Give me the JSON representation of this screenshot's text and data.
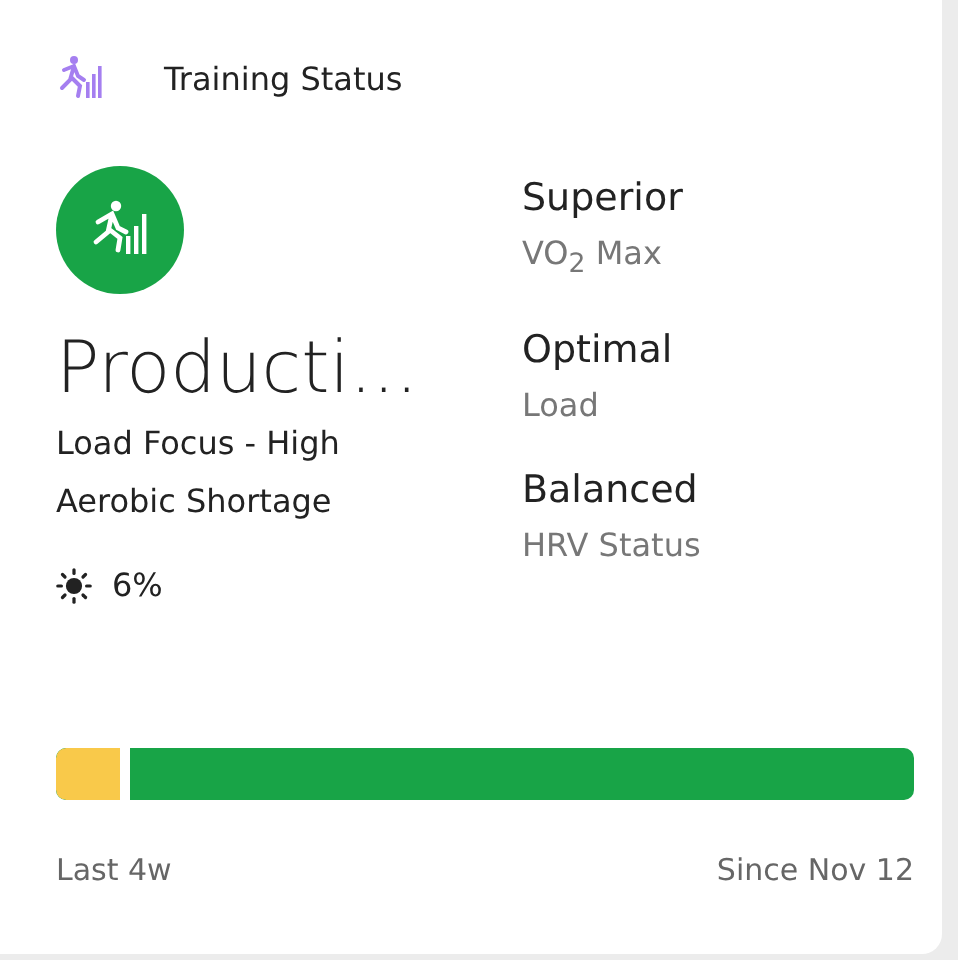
{
  "card": {
    "title": "Training Status"
  },
  "status": {
    "label": "Producti...",
    "details": [
      "Load Focus - High",
      "Aerobic Shortage"
    ],
    "heat": "6%"
  },
  "metrics": [
    {
      "value": "Superior",
      "label": "VO$_{2}$ Max"
    },
    {
      "value": "Optimal",
      "label": "Load"
    },
    {
      "value": "Balanced",
      "label": "HRV Status"
    }
  ],
  "bar": {
    "level": 0.075
  },
  "footer": {
    "left": "Last 4w",
    "right": "Since Nov 12"
  }
}
